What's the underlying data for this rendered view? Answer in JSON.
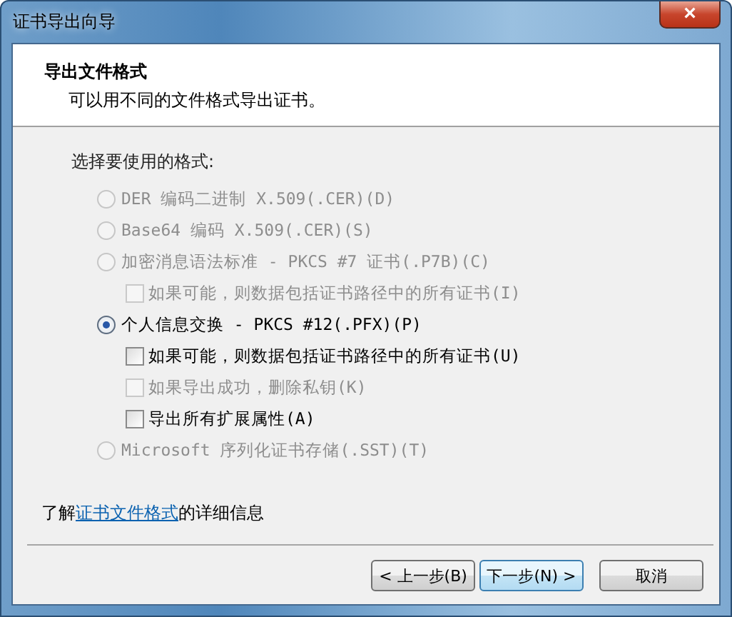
{
  "window": {
    "title": "证书导出向导",
    "close": "×"
  },
  "header": {
    "title": "导出文件格式",
    "subtitle": "可以用不同的文件格式导出证书。"
  },
  "format_label": "选择要使用的格式:",
  "options": [
    {
      "kind": "radio",
      "label": "DER 编码二进制 X.509(.CER)(D)",
      "selected": false,
      "disabled": true
    },
    {
      "kind": "radio",
      "label": "Base64 编码 X.509(.CER)(S)",
      "selected": false,
      "disabled": true
    },
    {
      "kind": "radio",
      "label": "加密消息语法标准 - PKCS #7 证书(.P7B)(C)",
      "selected": false,
      "disabled": true,
      "children": [
        {
          "kind": "checkbox",
          "label": "如果可能，则数据包括证书路径中的所有证书(I)",
          "checked": false,
          "disabled": true
        }
      ]
    },
    {
      "kind": "radio",
      "label": "个人信息交换 - PKCS #12(.PFX)(P)",
      "selected": true,
      "disabled": false,
      "children": [
        {
          "kind": "checkbox",
          "label": "如果可能，则数据包括证书路径中的所有证书(U)",
          "checked": false,
          "disabled": false
        },
        {
          "kind": "checkbox",
          "label": "如果导出成功，删除私钥(K)",
          "checked": false,
          "disabled": true
        },
        {
          "kind": "checkbox",
          "label": "导出所有扩展属性(A)",
          "checked": false,
          "disabled": false
        }
      ]
    },
    {
      "kind": "radio",
      "label": "Microsoft 序列化证书存储(.SST)(T)",
      "selected": false,
      "disabled": true
    }
  ],
  "info": {
    "before": "了解",
    "link": "证书文件格式",
    "after": "的详细信息"
  },
  "buttons": [
    {
      "label": "< 上一步(B)",
      "default": false
    },
    {
      "label": "下一步(N) >",
      "default": true
    },
    {
      "label": "取消",
      "default": false
    }
  ]
}
